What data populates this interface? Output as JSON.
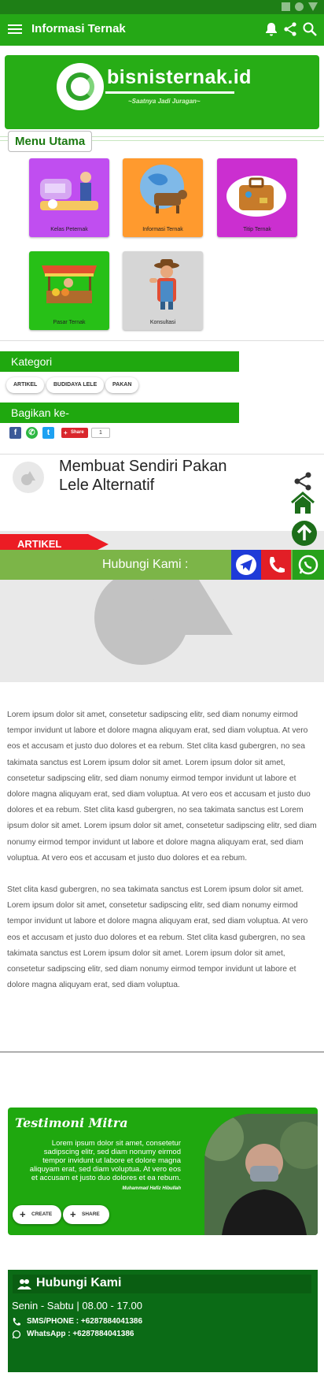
{
  "app": {
    "title": "Informasi Ternak"
  },
  "banner": {
    "brand": "bisnisternak.id",
    "tagline": "~Saatnya Jadi Juragan~"
  },
  "menu": {
    "title": "Menu Utama",
    "tiles": [
      {
        "label": "Kelas Peternak",
        "color": "#c04ef0"
      },
      {
        "label": "Informasi Ternak",
        "color": "#ff9a2e"
      },
      {
        "label": "Titip Ternak",
        "color": "#cb2fd0"
      },
      {
        "label": "Pasar Ternak",
        "color": "#27c017"
      },
      {
        "label": "Konsultasi",
        "color": "#d6d6d6"
      }
    ]
  },
  "kategori": {
    "title": "Kategori",
    "chips": [
      "ARTIKEL",
      "BUDIDAYA LELE",
      "PAKAN"
    ]
  },
  "bagikan": {
    "title": "Bagikan ke-",
    "share_label": "Share",
    "share_count": "1"
  },
  "post": {
    "title": "Membuat Sendiri Pakan Lele Alternatif",
    "category_tag": "ARTIKEL"
  },
  "contact_bar": {
    "label": "Hubungi Kami :"
  },
  "article": {
    "paragraphs": [
      "Lorem ipsum dolor sit amet, consetetur sadipscing elitr, sed diam nonumy eirmod tempor invidunt ut labore et dolore magna aliquyam erat, sed diam voluptua. At vero eos et accusam et justo duo dolores et ea rebum. Stet clita kasd gubergren, no sea takimata sanctus est Lorem ipsum dolor sit amet. Lorem ipsum dolor sit amet, consetetur sadipscing elitr, sed diam nonumy eirmod tempor invidunt ut labore et dolore magna aliquyam erat, sed diam voluptua. At vero eos et accusam et justo duo dolores et ea rebum. Stet clita kasd gubergren, no sea takimata sanctus est Lorem ipsum dolor sit amet. Lorem ipsum dolor sit amet, consetetur sadipscing elitr, sed diam nonumy eirmod tempor invidunt ut labore et dolore magna aliquyam erat, sed diam voluptua. At vero eos et accusam et justo duo dolores et ea rebum.",
      "Stet clita kasd gubergren, no sea takimata sanctus est Lorem ipsum dolor sit amet. Lorem ipsum dolor sit amet, consetetur sadipscing elitr, sed diam nonumy eirmod tempor invidunt ut labore et dolore magna aliquyam erat, sed diam voluptua. At vero eos et accusam et justo duo dolores et ea rebum. Stet clita kasd gubergren, no sea takimata sanctus est Lorem ipsum dolor sit amet. Lorem ipsum dolor sit amet, consetetur sadipscing elitr, sed diam nonumy eirmod tempor invidunt ut labore et dolore magna aliquyam erat, sed diam voluptua."
    ]
  },
  "testimoni": {
    "title": "Testimoni Mitra",
    "body": "Lorem ipsum dolor sit amet, consetetur sadipscing elitr, sed diam nonumy eirmod tempor invidunt ut labore et dolore magna aliquyam erat, sed diam voluptua. At vero eos et accusam et justo duo dolores et ea rebum.",
    "author": "Muhammad Hafiz Hibullah",
    "create_label": "CREATE",
    "share_label": "SHARE"
  },
  "footer": {
    "title": "Hubungi Kami",
    "hours": "Senin - Sabtu | 08.00 - 17.00",
    "phone": "SMS/PHONE : +6287884041386",
    "whatsapp": "WhatsApp : +6287884041386"
  },
  "colors": {
    "primary": "#25a816",
    "dark": "#0b6b16",
    "accent_red": "#ec1c24",
    "contact": "#7cb548"
  },
  "icons": [
    "menu-icon",
    "bell-icon",
    "share-icon",
    "search-icon",
    "home-icon",
    "arrow-up-icon",
    "telegram-icon",
    "phone-icon",
    "whatsapp-icon",
    "facebook-icon",
    "twitter-icon",
    "people-icon"
  ]
}
